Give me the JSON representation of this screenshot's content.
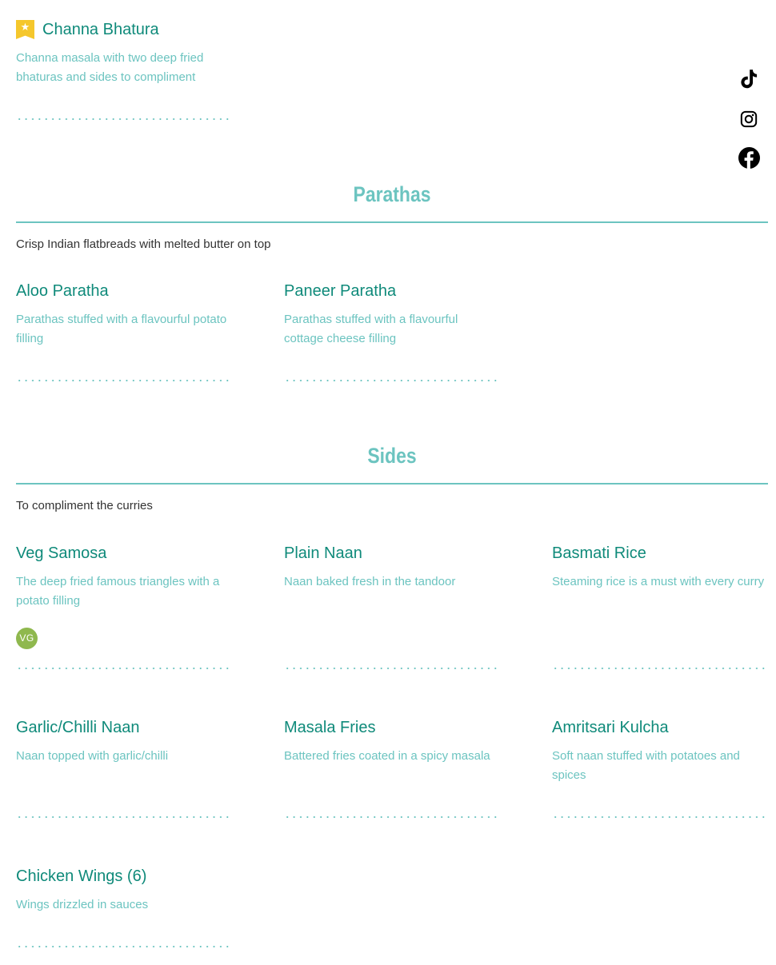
{
  "featured_item": {
    "title": "Channa Bhatura",
    "description": "Channa masala with two deep fried bhaturas and sides to compliment",
    "badge_icon": "star-badge-icon",
    "badge_color": "#f5c72c"
  },
  "social": {
    "icons": [
      "tiktok-icon",
      "instagram-icon",
      "facebook-icon"
    ]
  },
  "sections": [
    {
      "title": "Parathas",
      "description": "Crisp Indian flatbreads with melted butter on top",
      "items": [
        {
          "title": "Aloo Paratha",
          "description": "Parathas stuffed with a flavourful potato filling"
        },
        {
          "title": "Paneer Paratha",
          "description": "Parathas stuffed with a flavourful cottage cheese filling"
        }
      ]
    },
    {
      "title": "Sides",
      "description": "To compliment the curries",
      "items": [
        {
          "title": "Veg Samosa",
          "description": "The deep fried famous triangles with a potato filling",
          "badge": "VG"
        },
        {
          "title": "Plain Naan",
          "description": "Naan baked fresh in the tandoor"
        },
        {
          "title": "Basmati Rice",
          "description": "Steaming rice is a must with every curry"
        },
        {
          "title": "Garlic/Chilli Naan",
          "description": "Naan topped with garlic/chilli"
        },
        {
          "title": "Masala Fries",
          "description": "Battered fries coated in a spicy masala"
        },
        {
          "title": "Amritsari Kulcha",
          "description": "Soft naan stuffed with potatoes and spices"
        },
        {
          "title": "Chicken Wings (6)",
          "description": "Wings drizzled in sauces"
        }
      ]
    }
  ],
  "colors": {
    "title_text": "#0f8a7a",
    "description_text": "#6cc4c0",
    "section_accent": "#6cc4c0",
    "vegetarian_badge": "#8fb84e"
  }
}
